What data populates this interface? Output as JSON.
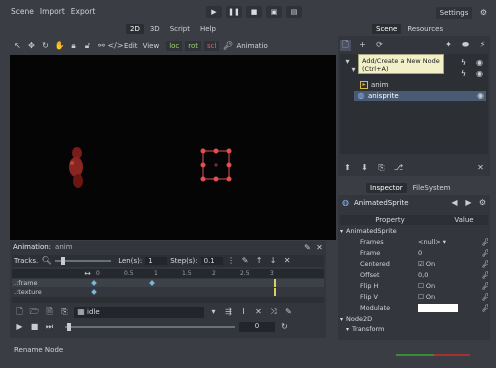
{
  "menu": [
    "Scene",
    "Import",
    "Export"
  ],
  "playback_icons": [
    "play-icon",
    "pause-icon",
    "stop-icon",
    "play-scene-icon",
    "play-custom-icon"
  ],
  "settings_label": "Settings",
  "view_tabs": [
    "2D",
    "3D",
    "Script",
    "Help"
  ],
  "toolbar": {
    "edit": "Edit",
    "view": "View",
    "loc": "loc",
    "rot": "rot",
    "scl": "scl",
    "animation": "Animatio"
  },
  "scene_tabs": [
    "Scene",
    "Resources"
  ],
  "scene_tree": {
    "tooltip_line1": "Add/Create a New Node",
    "tooltip_line2": "(Ctrl+A)",
    "node_anim": "anim",
    "node_anisprite": "anisprite"
  },
  "animation_panel": {
    "title": "Animation:",
    "anim_name": "anim",
    "tracks": "Tracks.",
    "len_label": "Len(s):",
    "len_value": "1",
    "step_label": "Step(s):",
    "step_value": "0.1",
    "track_frame": ".:frame",
    "track_texture": ".:texture",
    "ruler": [
      "0",
      "0.5",
      "1",
      "1.5",
      "2",
      "2.5",
      "3"
    ],
    "anim_select": "idle",
    "bottom_value": "0"
  },
  "inspector": {
    "tabs": [
      "Inspector",
      "FileSystem"
    ],
    "node_type": "AnimatedSprite",
    "col_property": "Property",
    "col_value": "Value",
    "section1": "AnimatedSprite",
    "rows": [
      {
        "name": "Frames",
        "value": "<null>"
      },
      {
        "name": "Frame",
        "value": "0"
      },
      {
        "name": "Centered",
        "value": "On"
      },
      {
        "name": "Offset",
        "value": "0,0"
      },
      {
        "name": "Flip H",
        "value": "On"
      },
      {
        "name": "Flip V",
        "value": "On"
      },
      {
        "name": "Modulate",
        "value": ""
      }
    ],
    "section2": "Node2D",
    "section3": "Transform"
  },
  "status": "Rename Node",
  "colors": {
    "accent_green": "#9bd26a",
    "selection": "#4a5a72",
    "tooltip_bg": "#f2f0c8",
    "handle_red": "#e05050"
  }
}
